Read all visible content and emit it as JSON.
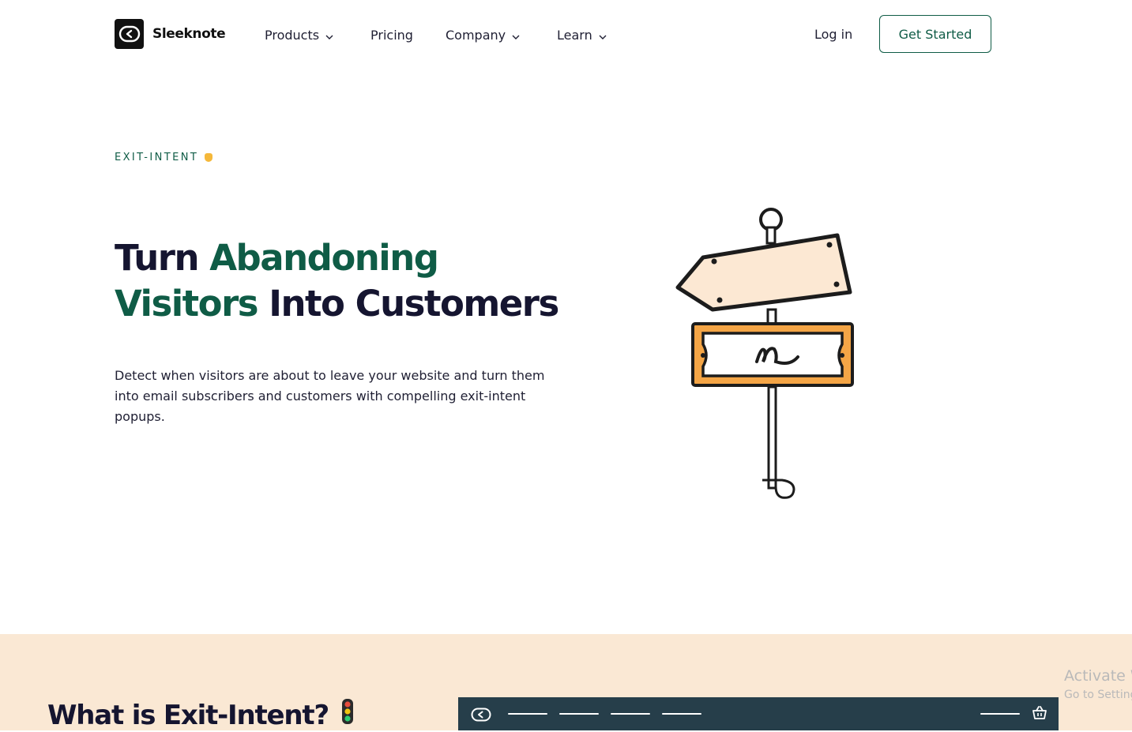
{
  "nav": {
    "brand": "Sleeknote",
    "items": [
      {
        "label": "Products",
        "has_dropdown": true
      },
      {
        "label": "Pricing",
        "has_dropdown": false
      },
      {
        "label": "Company",
        "has_dropdown": true
      },
      {
        "label": "Learn",
        "has_dropdown": true
      }
    ],
    "login": "Log in",
    "cta": "Get Started"
  },
  "hero": {
    "eyebrow": "EXIT-INTENT",
    "eyebrow_icon": "raised-hand-icon",
    "title": {
      "line1_plain": "Turn ",
      "line1_accent": "Abandoning",
      "line2_accent": "Visitors",
      "line2_plain": " Into Customers"
    },
    "description": "Detect when visitors are about to leave your website and turn them into email subscribers and customers with compelling exit-intent popups.",
    "illustration": "signpost-illustration"
  },
  "section2": {
    "title": "What is Exit-Intent?",
    "title_icon": "traffic-light-icon",
    "browser_icons": [
      "logo-icon",
      "basket-icon"
    ]
  },
  "watermark": {
    "line1": "Activate W",
    "line2": "Go to Setting"
  },
  "colors": {
    "brand_green": "#0f5c46",
    "heading_dark": "#151530",
    "section_bg": "#fae8d4",
    "browser_bar": "#263e4a",
    "sign_fill": "#fce8d3",
    "sign_orange": "#f4a546"
  }
}
